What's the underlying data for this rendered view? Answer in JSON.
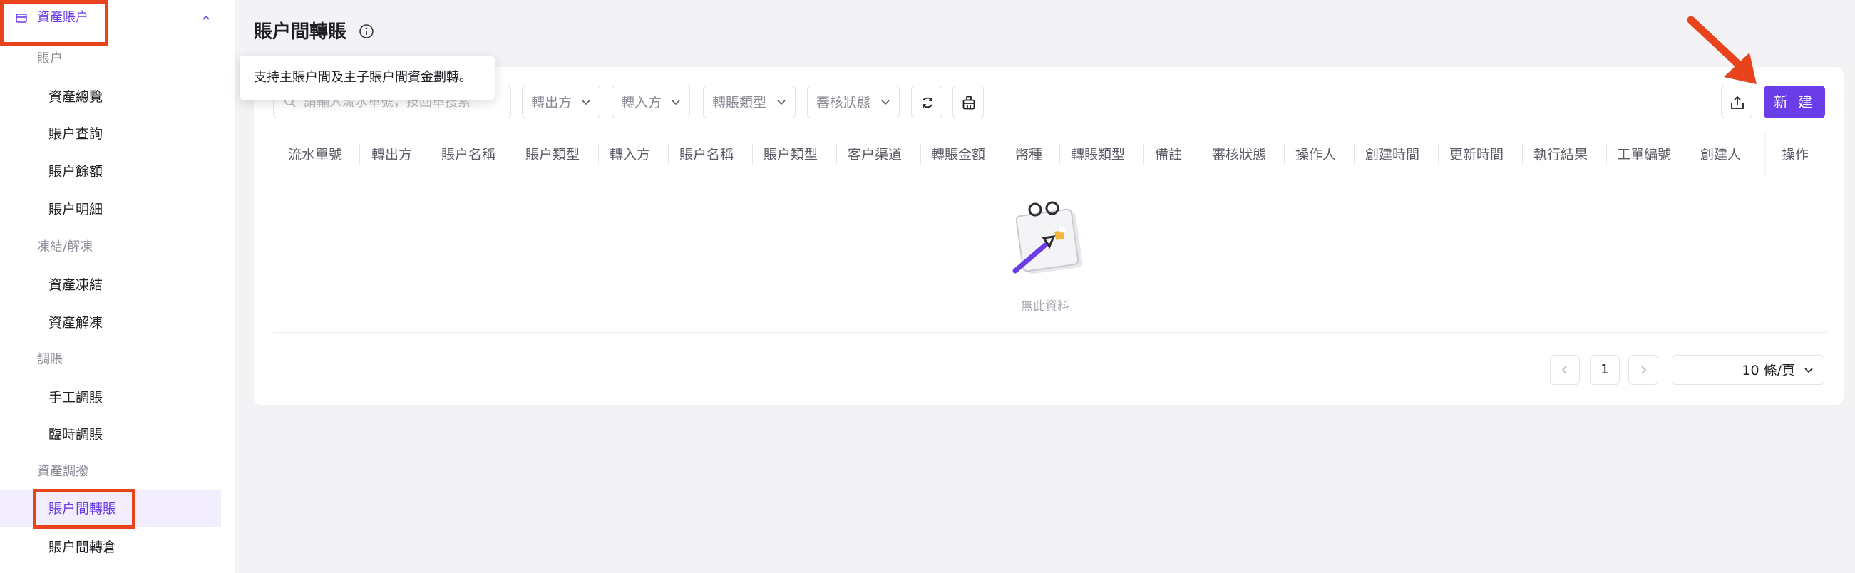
{
  "sidebar": {
    "section_title": "資產賬户",
    "groups": {
      "accounts": "賬户",
      "freeze": "凍結/解凍",
      "adjust": "調賬",
      "allocate": "資產調撥"
    },
    "items": {
      "overview": "資產總覽",
      "query": "賬户查詢",
      "balance": "賬户餘額",
      "detail": "賬户明細",
      "freeze": "資產凍結",
      "unfreeze": "資產解凍",
      "manual_adjust": "手工調賬",
      "temp_adjust": "臨時調賬",
      "transfer": "賬户間轉賬",
      "transfer_warehouse": "賬户間轉倉"
    },
    "active_item": "賬户間轉賬"
  },
  "page": {
    "title": "賬户間轉賬",
    "tooltip": "支持主賬户間及主子賬户間資金劃轉。"
  },
  "toolbar": {
    "search_placeholder": "請輸入流水單號，按回車搜索",
    "filters": {
      "from": "轉出方",
      "to": "轉入方",
      "type": "轉賬類型",
      "status": "審核狀態"
    },
    "new_button": "新 建"
  },
  "table": {
    "columns": [
      "流水單號",
      "轉出方",
      "賬户名稱",
      "賬户類型",
      "轉入方",
      "賬户名稱",
      "賬户類型",
      "客户渠道",
      "轉賬金額",
      "幣種",
      "轉賬類型",
      "備註",
      "審核狀態",
      "操作人",
      "創建時間",
      "更新時間",
      "執行結果",
      "工單編號",
      "創建人",
      "操作"
    ],
    "empty_text": "無此資料"
  },
  "pagination": {
    "current_page": "1",
    "page_size": "10 條/頁"
  },
  "colors": {
    "accent": "#6a3de8",
    "highlight": "#e8431c"
  }
}
